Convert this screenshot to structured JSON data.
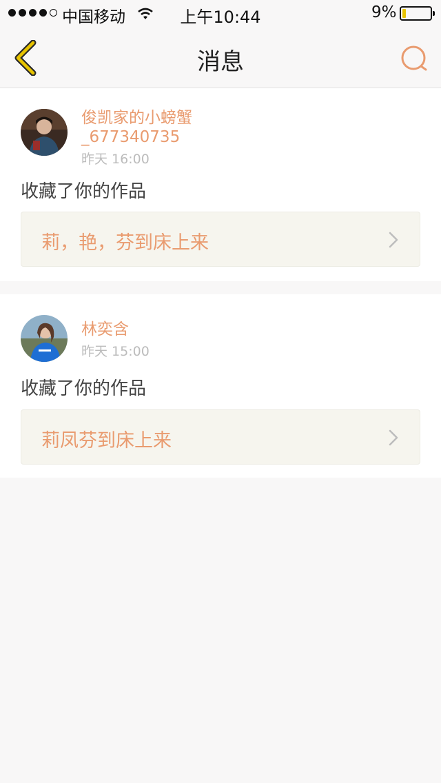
{
  "status_bar": {
    "carrier": "中国移动",
    "time": "上午10:44",
    "battery": "9%",
    "battery_level": 0.09,
    "signal_bars": 4
  },
  "header": {
    "title": "消息",
    "back_icon": "chevron-left-icon",
    "search_icon": "search-icon"
  },
  "messages": [
    {
      "user_line1": "俊凯家的小螃蟹",
      "user_line2": "_677340735",
      "time": "昨天 16:00",
      "action": "收藏了你的作品",
      "work_title": "莉，艳，芬到床上来"
    },
    {
      "user_line1": "林奕含",
      "time": "昨天 15:00",
      "action": "收藏了你的作品",
      "work_title": "莉凤芬到床上来"
    }
  ],
  "colors": {
    "accent": "#e99b6f",
    "back_icon": "#e7c300",
    "background": "#f8f7f7"
  }
}
